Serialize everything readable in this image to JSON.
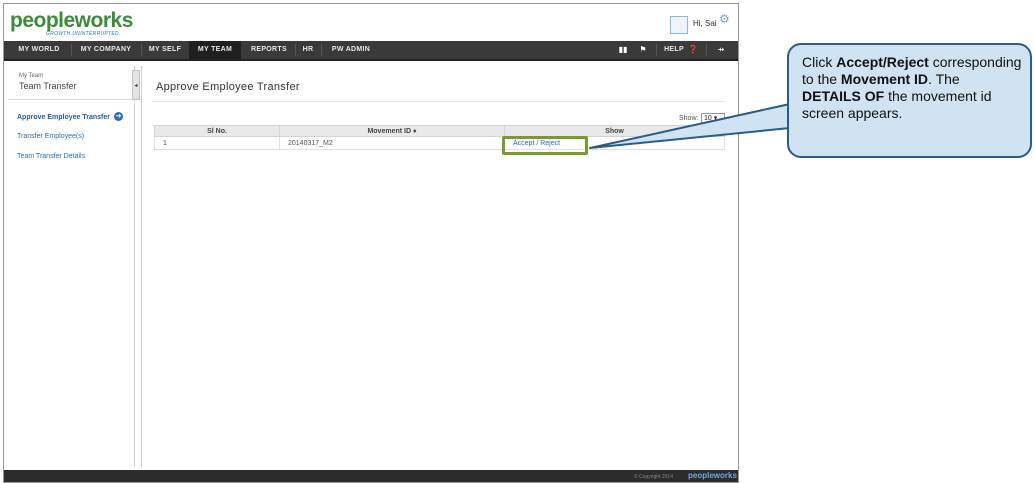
{
  "header": {
    "logo_text": "peopleworks",
    "tagline": "GROWTH.UNINTERRUPTED.",
    "greeting": "Hi, Sai"
  },
  "nav": {
    "items": [
      "MY WORLD",
      "MY COMPANY",
      "MY SELF",
      "MY TEAM",
      "REPORTS",
      "HR",
      "PW ADMIN"
    ],
    "active": "MY TEAM",
    "help_label": "HELP"
  },
  "sidebar": {
    "subtitle": "My Team",
    "title": "Team Transfer",
    "links": [
      "Approve Employee Transfer",
      "Transfer Employee(s)",
      "Team Transfer Details"
    ]
  },
  "main": {
    "page_title": "Approve Employee Transfer",
    "show_label": "Show:",
    "show_value": "10 ▾",
    "table": {
      "headers": [
        "Sl No.",
        "Movement ID ♦",
        "Show"
      ],
      "rows": [
        {
          "sl": "1",
          "movement_id": "20140317_M2",
          "action": "Accept / Reject"
        }
      ]
    }
  },
  "footer": {
    "copyright": "© Copyright 2014",
    "logo": "peopleworks"
  },
  "callout": {
    "t1": "Click ",
    "b1": "Accept/Reject",
    "t2": " corresponding to the ",
    "b2": "Movement ID",
    "t3": ". The ",
    "b3": "DETAILS OF",
    "t4": " the movement id screen appears."
  },
  "colors": {
    "nav_bg": "#3a3a3a",
    "link": "#2a6fb0",
    "highlight": "#7a9a2e",
    "callout_bg": "#cfe3f3",
    "callout_border": "#2b5c8a"
  }
}
